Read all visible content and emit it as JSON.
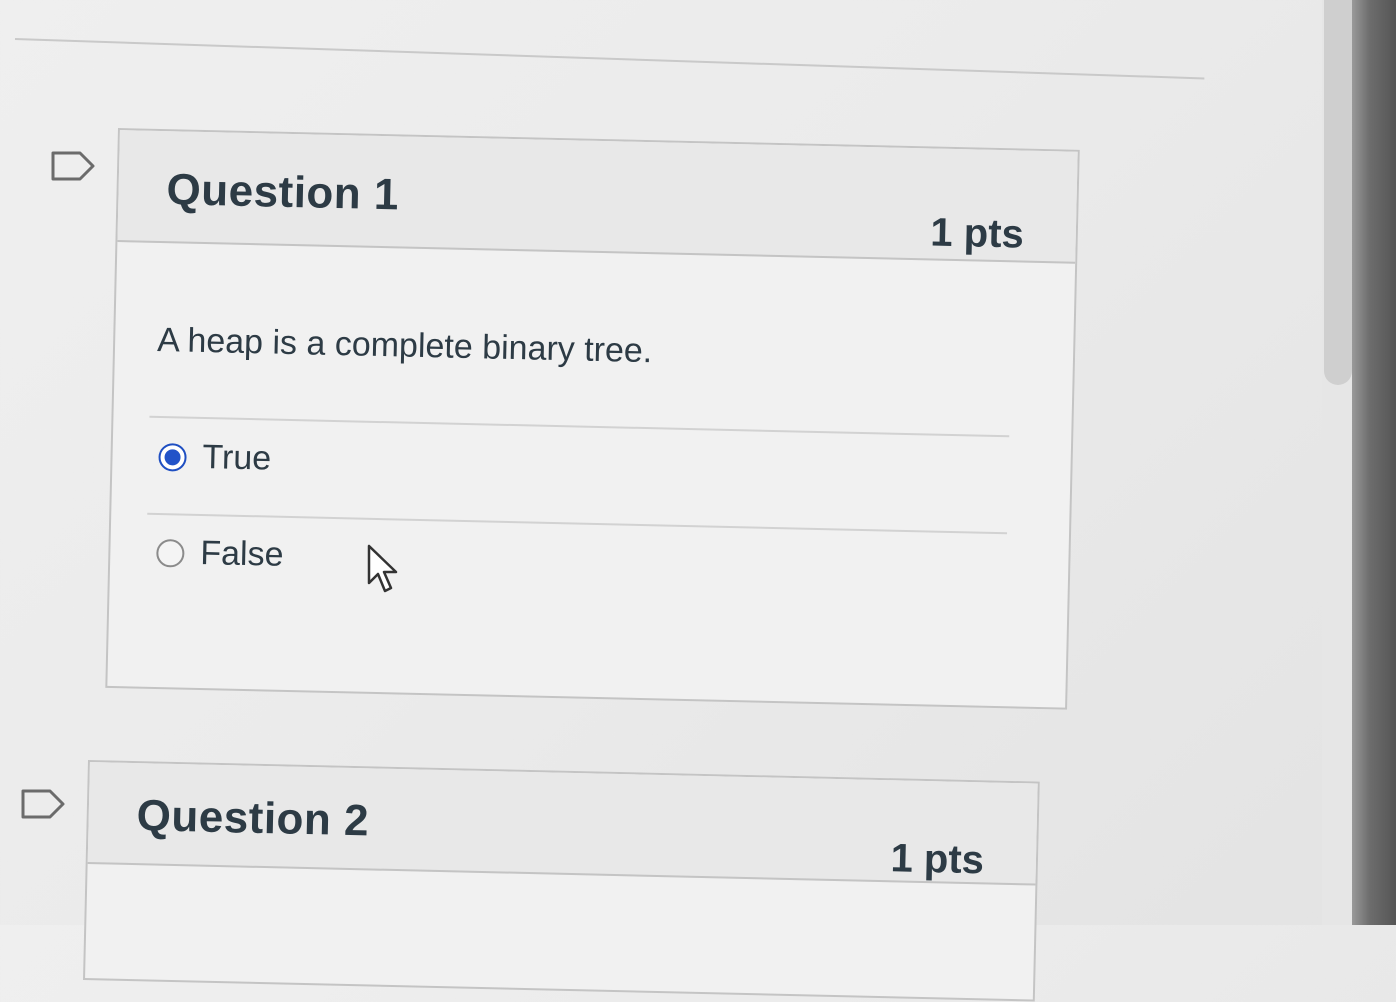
{
  "questions": [
    {
      "title": "Question 1",
      "points": "1 pts",
      "text": "A heap is a complete binary tree.",
      "answers": [
        {
          "label": "True",
          "selected": true
        },
        {
          "label": "False",
          "selected": false
        }
      ]
    },
    {
      "title": "Question 2",
      "points": "1 pts"
    }
  ],
  "icons": {
    "flag": "flag-icon",
    "cursor": "mouse-pointer-icon"
  },
  "colors": {
    "radio_selected": "#2253c8",
    "text": "#2d3b45",
    "header_bg": "#e8e8e8",
    "border": "#c4c4c4"
  }
}
